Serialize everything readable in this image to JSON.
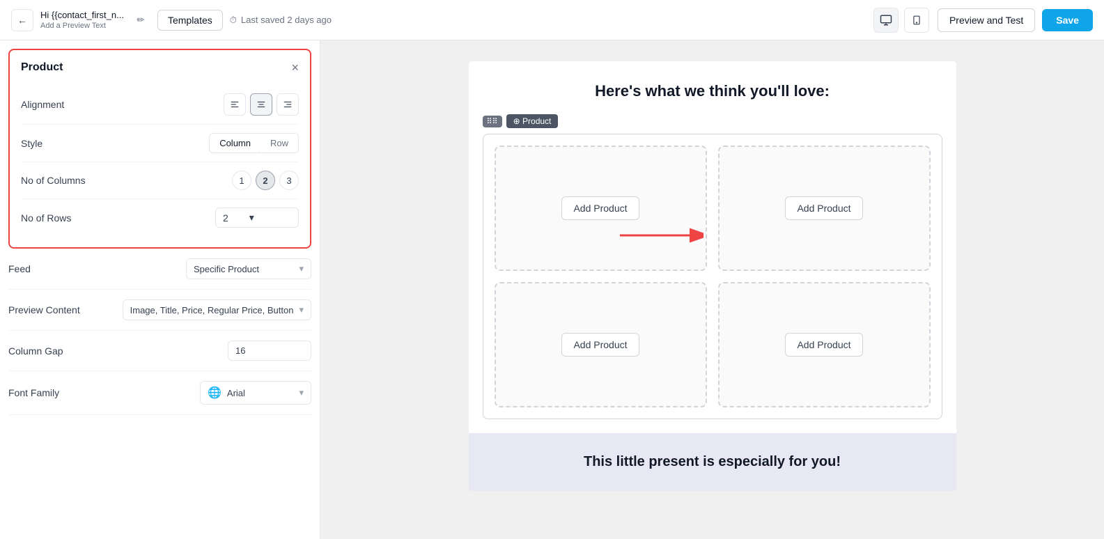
{
  "topbar": {
    "back_label": "←",
    "subject": "Hi {{contact_first_n...",
    "preview_text": "Add a Preview Text",
    "edit_icon": "✏",
    "templates_label": "Templates",
    "saved_label": "Last saved 2 days ago",
    "clock_icon": "⏱",
    "desktop_icon": "🖥",
    "mobile_icon": "📱",
    "preview_test_label": "Preview and Test",
    "save_label": "Save"
  },
  "left_panel": {
    "product_card": {
      "title": "Product",
      "close_icon": "×",
      "alignment": {
        "label": "Alignment",
        "options": [
          "≡",
          "≡",
          "≡"
        ],
        "active_index": 1
      },
      "style": {
        "label": "Style",
        "options": [
          "Column",
          "Row"
        ],
        "active_index": 0
      },
      "no_of_columns": {
        "label": "No of Columns",
        "options": [
          "1",
          "2",
          "3"
        ],
        "active_index": 1
      },
      "no_of_rows": {
        "label": "No of Rows",
        "value": "2",
        "caret": "▾"
      }
    },
    "feed": {
      "label": "Feed",
      "value": "Specific Product",
      "caret": "▾"
    },
    "preview_content": {
      "label": "Preview Content",
      "value": "Image, Title, Price, Regular Price, Button",
      "caret": "▾"
    },
    "column_gap": {
      "label": "Column Gap",
      "value": "16"
    },
    "font_family": {
      "label": "Font Family",
      "globe_icon": "🌐",
      "value": "Arial",
      "caret": "▾"
    }
  },
  "canvas": {
    "email_header": "Here's what we think you'll love:",
    "product_block": {
      "drag_handle": "⠿⠿",
      "block_label": "⊕ Product"
    },
    "product_cells": [
      {
        "label": "Add Product"
      },
      {
        "label": "Add Product"
      },
      {
        "label": "Add Product"
      },
      {
        "label": "Add Product"
      }
    ],
    "bottom_text": "This little present is especially for you!"
  }
}
